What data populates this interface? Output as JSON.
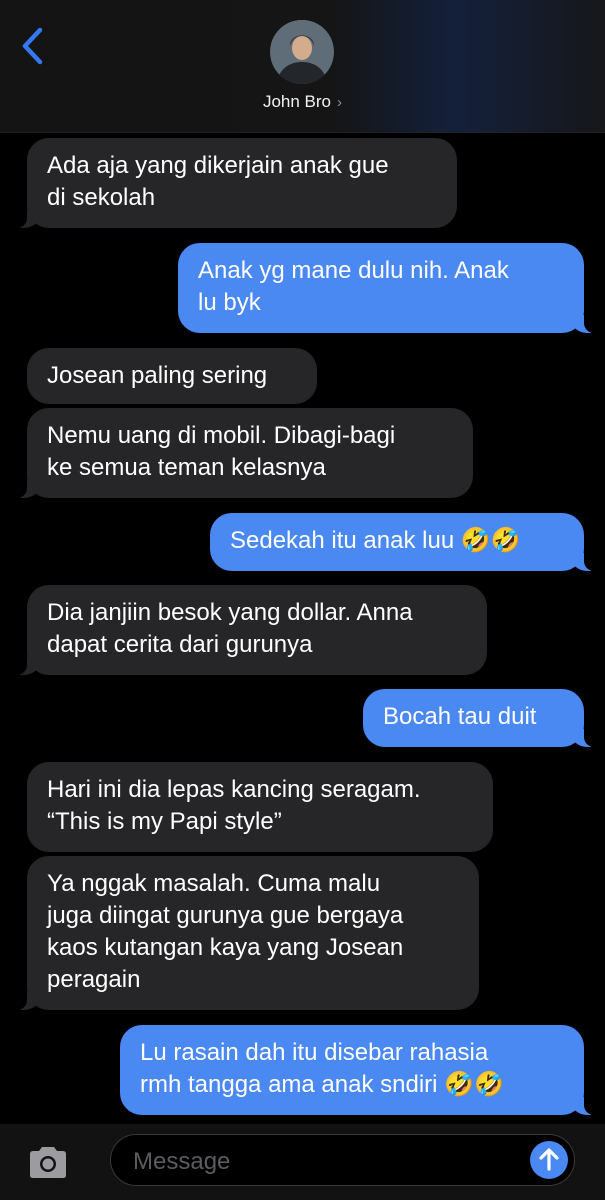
{
  "header": {
    "contact_name": "John Bro",
    "chevron": "›"
  },
  "messages": [
    {
      "from": "contact",
      "text": "Ada aja yang dikerjain anak gue\ndi sekolah"
    },
    {
      "from": "me",
      "text": "Anak yg mane dulu nih. Anak\nlu byk"
    },
    {
      "from": "contact",
      "text": "Josean paling sering"
    },
    {
      "from": "contact",
      "text": "Nemu uang di mobil. Dibagi-bagi\nke semua teman kelasnya"
    },
    {
      "from": "me",
      "text": "Sedekah itu anak luu 🤣🤣"
    },
    {
      "from": "contact",
      "text": "Dia janjiin besok yang dollar. Anna\ndapat cerita dari gurunya"
    },
    {
      "from": "me",
      "text": "Bocah tau duit"
    },
    {
      "from": "contact",
      "text": "Hari ini dia lepas kancing seragam.\n“This is my Papi style”"
    },
    {
      "from": "contact",
      "text": "Ya nggak masalah. Cuma malu\njuga diingat gurunya gue bergaya\nkaos kutangan kaya yang Josean\nperagain"
    },
    {
      "from": "me",
      "text": "Lu rasain dah itu disebar rahasia\nrmh tangga ama anak sndiri 🤣🤣"
    }
  ],
  "composer": {
    "placeholder": "Message"
  },
  "icons": {
    "back": "back-chevron-icon",
    "avatar": "contact-avatar",
    "camera": "camera-icon",
    "send": "send-arrow-icon"
  },
  "colors": {
    "incoming_bubble": "#262628",
    "outgoing_bubble": "#4a88f2",
    "accent": "#3478f6"
  }
}
